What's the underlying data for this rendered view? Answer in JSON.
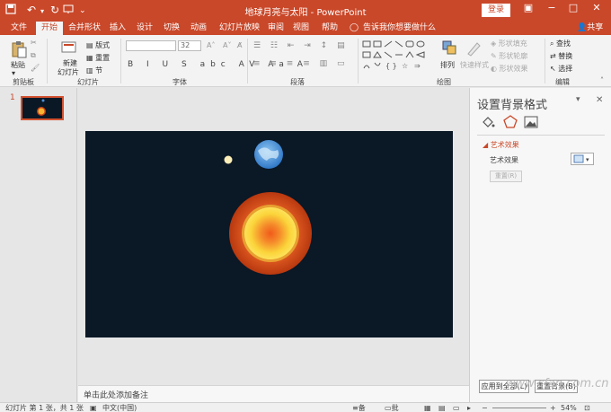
{
  "window": {
    "title": "地球月亮与太阳 - PowerPoint",
    "login_label": "登录",
    "share_label": "共享"
  },
  "tabs": [
    {
      "label": "文件"
    },
    {
      "label": "开始"
    },
    {
      "label": "合并形状"
    },
    {
      "label": "插入"
    },
    {
      "label": "设计"
    },
    {
      "label": "切换"
    },
    {
      "label": "动画"
    },
    {
      "label": "幻灯片放映"
    },
    {
      "label": "审阅"
    },
    {
      "label": "视图"
    },
    {
      "label": "帮助"
    }
  ],
  "tell_me": "告诉我你想要做什么",
  "ribbon": {
    "clipboard": {
      "paste": "粘贴",
      "group": "剪贴板"
    },
    "slides": {
      "new_slide": "新建",
      "new_slide2": "幻灯片",
      "layout": "版式",
      "reset": "重置",
      "section": "节",
      "group": "幻灯片"
    },
    "font": {
      "size": "32",
      "group": "字体"
    },
    "paragraph": {
      "group": "段落"
    },
    "drawing": {
      "arrange": "排列",
      "quick_styles": "快速样式",
      "fill": "形状填充",
      "outline": "形状轮廓",
      "effects": "形状效果",
      "group": "绘图"
    },
    "editing": {
      "find": "查找",
      "replace": "替换",
      "select": "选择",
      "group": "编辑"
    }
  },
  "thumbnails": {
    "number": "1"
  },
  "notes": {
    "placeholder": "单击此处添加备注"
  },
  "panel": {
    "title": "设置背景格式",
    "section": "艺术效果",
    "field": "艺术效果",
    "reset": "重置(R)",
    "apply_all": "应用到全部(L)",
    "reset_bg": "重置背景(B)"
  },
  "status": {
    "slide_info": "幻灯片 第 1 张，共 1 张",
    "language": "中文(中国)",
    "notes": "备注",
    "comments": "批注",
    "zoom": "54%"
  },
  "colors": {
    "accent": "#c9482a",
    "slide_bg": "#0b1826"
  },
  "watermark": "www.cfan.com.cn"
}
